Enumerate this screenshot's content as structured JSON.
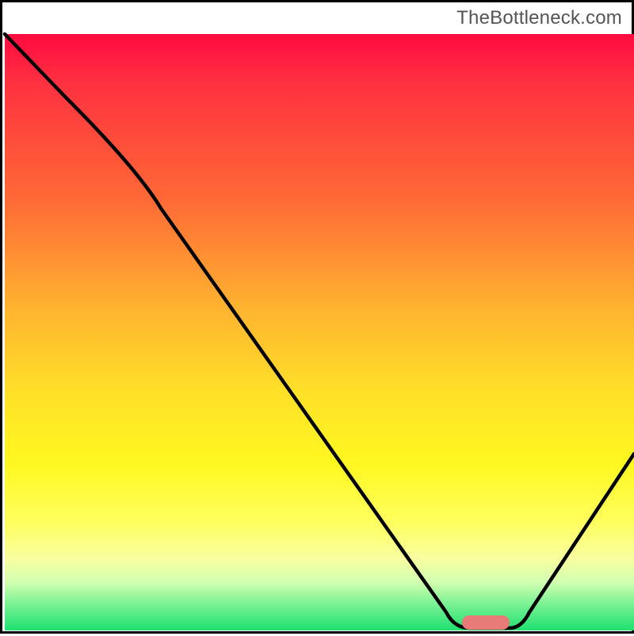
{
  "watermark": "TheBottleneck.com",
  "chart_data": {
    "type": "line",
    "title": "",
    "xlabel": "",
    "ylabel": "",
    "xlim": [
      0,
      100
    ],
    "ylim": [
      0,
      100
    ],
    "grid": false,
    "legend": false,
    "x": [
      0,
      20,
      72,
      80,
      100
    ],
    "values": [
      100,
      80,
      0,
      0,
      28
    ],
    "notes": "V-shaped bottleneck curve on red-to-green gradient; minimum plateau marked with rounded bar.",
    "marker": {
      "x_center": 76,
      "y": 0,
      "width_pct": 8,
      "color": "#e87a77"
    },
    "background_gradient": [
      "#ff0a40",
      "#ff6a36",
      "#ffe028",
      "#ffff60",
      "#20e070"
    ]
  }
}
